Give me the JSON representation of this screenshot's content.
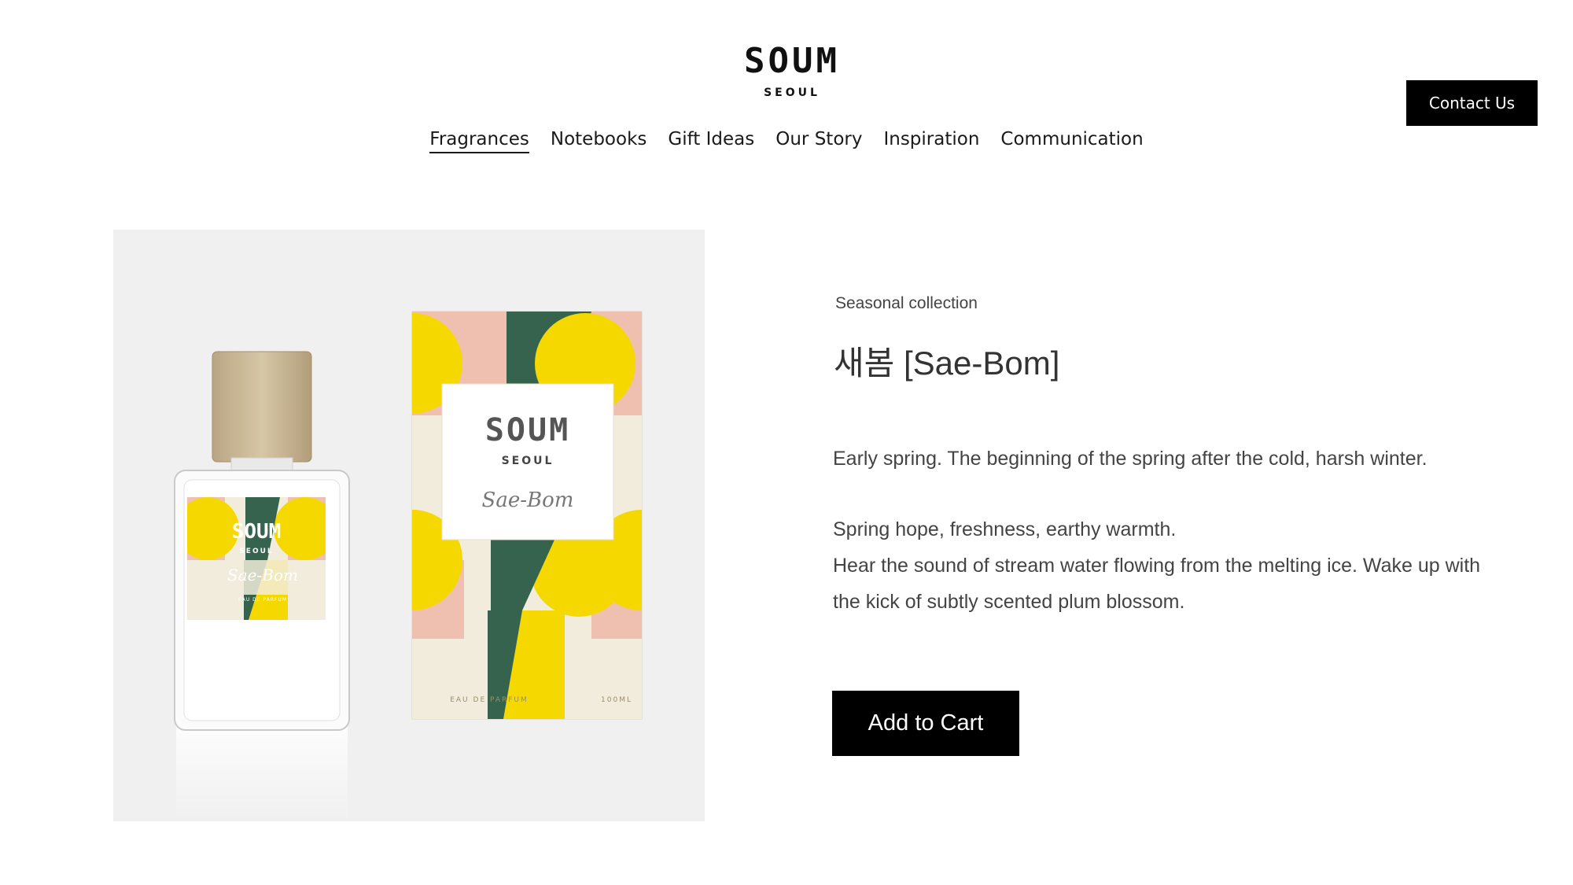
{
  "brand": {
    "name": "SOUM",
    "city": "SEOUL"
  },
  "nav": {
    "items": [
      {
        "label": "Fragrances",
        "active": true
      },
      {
        "label": "Notebooks"
      },
      {
        "label": "Gift Ideas"
      },
      {
        "label": "Our Story"
      },
      {
        "label": "Inspiration"
      },
      {
        "label": "Communication"
      }
    ]
  },
  "header": {
    "contact_label": "Contact Us"
  },
  "product": {
    "collection": "Seasonal collection",
    "title": "새봄 [Sae-Bom]",
    "description": {
      "line1": "Early spring. The beginning of the spring after the cold, harsh winter.",
      "line2": "Spring hope, freshness, earthy warmth.",
      "line3": "Hear the sound of stream water flowing from the melting ice. Wake up with the kick of subtly scented plum blossom."
    },
    "add_to_cart_label": "Add to Cart",
    "image": {
      "bottle_brand": "SOUM",
      "bottle_city": "SEOUL",
      "bottle_name": "Sae-Bom",
      "bottle_type": "EAU DE PARFUM",
      "box_brand": "SOUM",
      "box_city": "SEOUL",
      "box_name": "Sae-Bom",
      "box_type": "EAU DE PARFUM",
      "box_volume": "100ML"
    }
  },
  "colors": {
    "accent_black": "#000000",
    "pattern_yellow": "#f5d800",
    "pattern_green": "#36634d",
    "pattern_pink": "#efc0b0",
    "pattern_cream": "#f2ecdc",
    "image_bg": "#f0f0f0"
  }
}
